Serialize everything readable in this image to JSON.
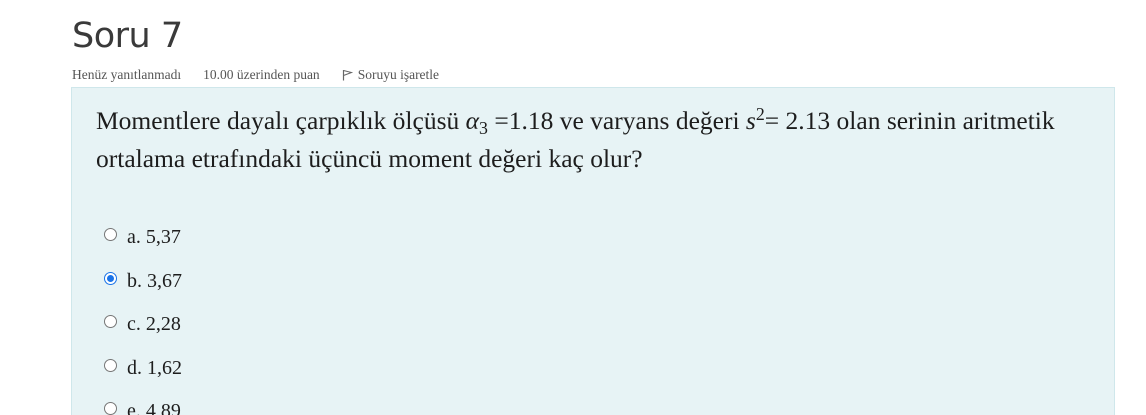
{
  "question": {
    "title": "Soru 7",
    "state": "Henüz yanıtlanmadı",
    "grade": "10.00 üzerinden puan",
    "flag_label": "Soruyu işaretle",
    "text_part1": "Momentlere dayalı çarpıklık ölçüsü",
    "alpha_symbol": "α",
    "alpha_subscript": "3",
    "text_part2": "=1.18 ve varyans değeri",
    "s_symbol": "s",
    "s_superscript": "2",
    "text_part3": "= 2.13 olan serinin aritmetik ortalama etrafındaki üçüncü moment değeri kaç olur?"
  },
  "answers": [
    {
      "letter": "a.",
      "value": "5,37",
      "selected": false
    },
    {
      "letter": "b.",
      "value": "3,67",
      "selected": true
    },
    {
      "letter": "c.",
      "value": "2,28",
      "selected": false
    },
    {
      "letter": "d.",
      "value": "1,62",
      "selected": false
    },
    {
      "letter": "e.",
      "value": "4,89",
      "selected": false
    }
  ],
  "colors": {
    "question_bg": "#e7f3f5",
    "selected_radio": "#1a73e8"
  },
  "icons": {
    "flag": "flag-icon"
  }
}
